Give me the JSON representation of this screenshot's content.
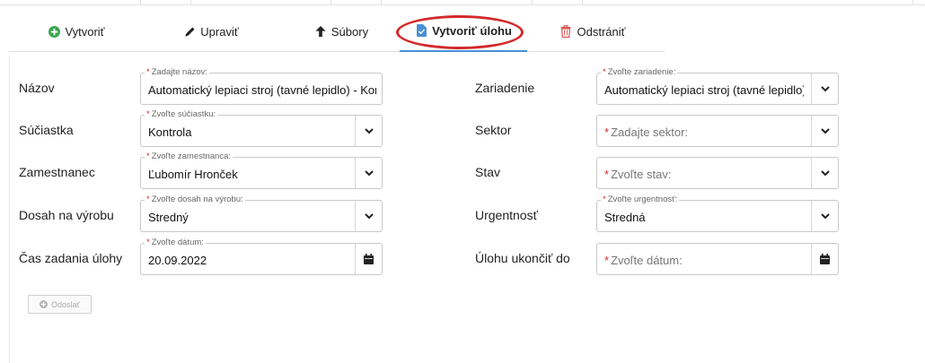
{
  "tabs": {
    "create": "Vytvoriť",
    "edit": "Upraviť",
    "files": "Súbory",
    "create_task": "Vytvoriť úlohu",
    "delete": "Odstrániť"
  },
  "form": {
    "name": {
      "label": "Názov",
      "float": "Zadajte názov:",
      "value": "Automatický lepiaci stroj (tavné lepidlo) - Kontrola"
    },
    "part": {
      "label": "Súčiastka",
      "float": "Zvoľte súčiastku:",
      "value": "Kontrola"
    },
    "employee": {
      "label": "Zamestnanec",
      "float": "Zvoľte zamestnanca:",
      "value": "Ľubomír Hronček"
    },
    "reach": {
      "label": "Dosah na výrobu",
      "float": "Zvoľte dosah na výrobu:",
      "value": "Stredný"
    },
    "assigned": {
      "label": "Čas zadania úlohy",
      "float": "Zvoľte dátum:",
      "value": "20.09.2022"
    },
    "device": {
      "label": "Zariadenie",
      "float": "Zvoľte zariadenie:",
      "value": "Automatický lepiaci stroj (tavné lepidlo)"
    },
    "sector": {
      "label": "Sektor",
      "placeholder": "Zadajte sektor:"
    },
    "status": {
      "label": "Stav",
      "placeholder": "Zvoľte stav:"
    },
    "urgency": {
      "label": "Urgentnosť",
      "float": "Zvoľte urgentnosť:",
      "value": "Stredná"
    },
    "due": {
      "label": "Úlohu ukončiť do",
      "placeholder": "Zvoľte dátum:"
    },
    "required_mark": "*"
  },
  "submit": {
    "label": "Odoslať"
  },
  "colors": {
    "accent": "#4a8fd6",
    "highlight": "#d22a2a",
    "add_icon": "#3aa64c",
    "delete_icon": "#d9534f"
  },
  "icons": [
    "plus-circle-icon",
    "pencil-icon",
    "arrow-up-icon",
    "task-document-icon",
    "trash-icon",
    "chevron-down-icon",
    "calendar-icon"
  ]
}
